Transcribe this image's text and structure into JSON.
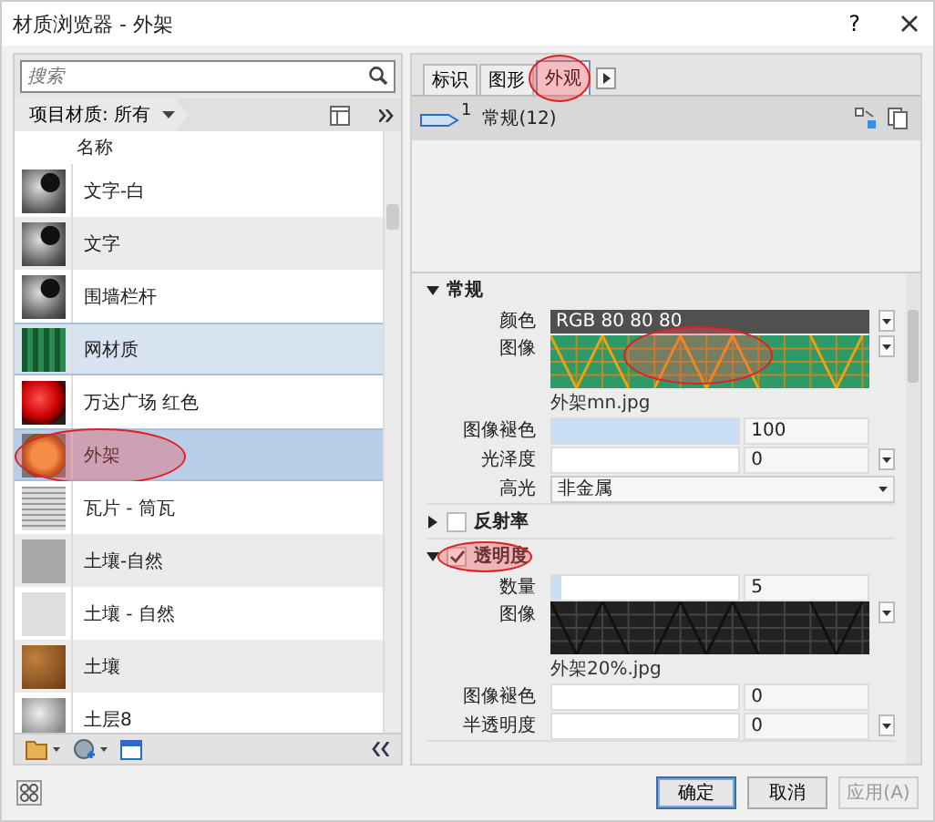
{
  "window": {
    "title": "材质浏览器 - 外架",
    "help": "?"
  },
  "search": {
    "placeholder": "搜索"
  },
  "filter": {
    "label": "项目材质: 所有"
  },
  "list": {
    "column": "名称",
    "items": [
      {
        "name": "文字-白",
        "kind": "sphere",
        "selected": false,
        "highlighted": false
      },
      {
        "name": "文字",
        "kind": "sphere",
        "selected": false,
        "highlighted": false
      },
      {
        "name": "围墙栏杆",
        "kind": "sphere",
        "selected": false,
        "highlighted": false
      },
      {
        "name": "网材质",
        "kind": "mesh",
        "selected": true,
        "highlighted": false
      },
      {
        "name": "万达广场 红色",
        "kind": "red",
        "selected": false,
        "highlighted": false
      },
      {
        "name": "外架",
        "kind": "orange",
        "selected": true,
        "highlighted": true
      },
      {
        "name": "瓦片 - 筒瓦",
        "kind": "tile",
        "selected": false,
        "highlighted": false
      },
      {
        "name": "土壤-自然",
        "kind": "gray",
        "selected": false,
        "highlighted": false
      },
      {
        "name": "土壤 - 自然",
        "kind": "light",
        "selected": false,
        "highlighted": false
      },
      {
        "name": "土壤",
        "kind": "soil",
        "selected": false,
        "highlighted": false
      },
      {
        "name": "土层8",
        "kind": "ball",
        "selected": false,
        "highlighted": false
      }
    ]
  },
  "tabs": [
    {
      "label": "标识",
      "selected": false,
      "highlighted": false
    },
    {
      "label": "图形",
      "selected": false,
      "highlighted": false
    },
    {
      "label": "外观",
      "selected": true,
      "highlighted": true
    }
  ],
  "asset": {
    "number": "1",
    "name": "常规(12)"
  },
  "sections": [
    {
      "title": "常规",
      "kind": "plain",
      "expanded": true,
      "highlighted": false,
      "rows": [
        {
          "kind": "color",
          "label": "颜色",
          "value": "RGB 80 80 80"
        },
        {
          "kind": "texture",
          "label": "图像",
          "file": "外架mn.jpg",
          "highlighted": true
        },
        {
          "kind": "slider",
          "label": "图像褪色",
          "level": 1,
          "value": "100",
          "dropdown": false
        },
        {
          "kind": "slider",
          "label": "光泽度",
          "level": 0,
          "value": "0",
          "dropdown": true
        },
        {
          "kind": "select",
          "label": "高光",
          "value": "非金属"
        }
      ]
    },
    {
      "title": "反射率",
      "kind": "toggle",
      "expanded": false,
      "checked": false,
      "highlighted": false
    },
    {
      "title": "透明度",
      "kind": "toggle",
      "expanded": true,
      "checked": true,
      "highlighted": true,
      "rows": [
        {
          "kind": "slider",
          "label": "数量",
          "level": 0.05,
          "value": "5",
          "dropdown": false
        },
        {
          "kind": "mask",
          "label": "图像",
          "file": "外架20%.jpg",
          "highlighted": false
        },
        {
          "kind": "slider",
          "label": "图像褪色",
          "level": 0,
          "value": "0",
          "dropdown": false
        },
        {
          "kind": "slider",
          "label": "半透明度",
          "level": 0,
          "value": "0",
          "dropdown": true
        }
      ]
    }
  ],
  "buttons": [
    {
      "label": "确定",
      "default": true,
      "disabled": false
    },
    {
      "label": "取消",
      "default": false,
      "disabled": false
    },
    {
      "label": "应用(A)",
      "default": false,
      "disabled": true
    }
  ]
}
